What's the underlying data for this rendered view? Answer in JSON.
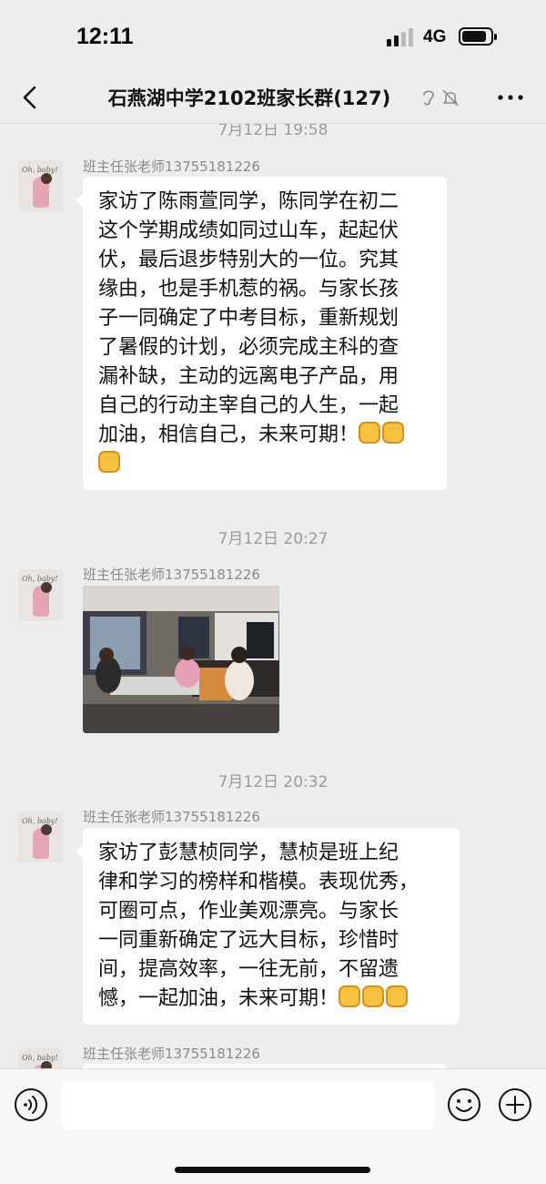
{
  "status_bar": {
    "time": "12:11",
    "network": "4G"
  },
  "header": {
    "title": "石燕湖中学2102班家长群(127)"
  },
  "messages": [
    {
      "timestamp": "7月12日 19:58",
      "sender": "班主任张老师13755181226",
      "lines": [
        "家访了陈雨萱同学，陈同学在初二",
        "这个学期成绩如同过山车，起起伏",
        "伏，最后退步特别大的一位。究其",
        "缘由，也是手机惹的祸。与家长孩",
        "子一同确定了中考目标，重新规划",
        "了暑假的计划，必须完成主科的查",
        "漏补缺，主动的远离电子产品，用",
        "自己的行动主宰自己的人生，一起",
        "加油，相信自己，未来可期！"
      ],
      "emoji": "fist-emoji"
    },
    {
      "timestamp": "7月12日 20:27",
      "sender": "班主任张老师13755181226",
      "type": "photo"
    },
    {
      "timestamp": "7月12日 20:32",
      "sender": "班主任张老师13755181226",
      "lines": [
        "家访了彭慧桢同学，慧桢是班上纪",
        "律和学习的榜样和楷模。表现优秀，",
        "可圈可点，作业美观漂亮。与家长",
        "一同重新确定了远大目标，珍惜时",
        "间，提高效率，一往无前，不留遗",
        "憾，一起加油，未来可期！"
      ],
      "emoji": "fist-emoji"
    },
    {
      "sender": "班主任张老师13755181226"
    }
  ],
  "avatar_text": "Oh, baby!",
  "input": {
    "placeholder": ""
  },
  "colors": {
    "background": "#ededed",
    "bubble": "#ffffff",
    "timestamp": "#9a9a9a",
    "sender": "#8a8a8a"
  }
}
